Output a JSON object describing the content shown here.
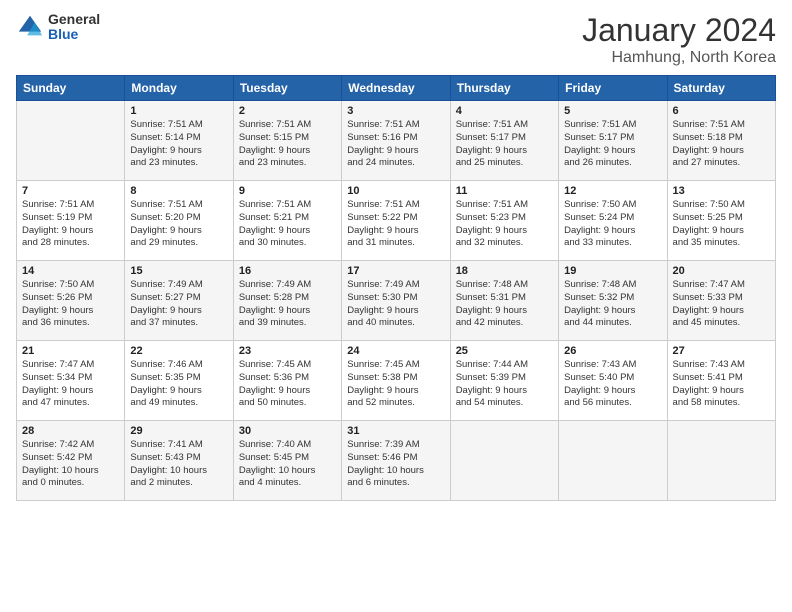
{
  "header": {
    "logo_general": "General",
    "logo_blue": "Blue",
    "month_title": "January 2024",
    "location": "Hamhung, North Korea"
  },
  "columns": [
    "Sunday",
    "Monday",
    "Tuesday",
    "Wednesday",
    "Thursday",
    "Friday",
    "Saturday"
  ],
  "weeks": [
    [
      {
        "day": "",
        "content": ""
      },
      {
        "day": "1",
        "content": "Sunrise: 7:51 AM\nSunset: 5:14 PM\nDaylight: 9 hours\nand 23 minutes."
      },
      {
        "day": "2",
        "content": "Sunrise: 7:51 AM\nSunset: 5:15 PM\nDaylight: 9 hours\nand 23 minutes."
      },
      {
        "day": "3",
        "content": "Sunrise: 7:51 AM\nSunset: 5:16 PM\nDaylight: 9 hours\nand 24 minutes."
      },
      {
        "day": "4",
        "content": "Sunrise: 7:51 AM\nSunset: 5:17 PM\nDaylight: 9 hours\nand 25 minutes."
      },
      {
        "day": "5",
        "content": "Sunrise: 7:51 AM\nSunset: 5:17 PM\nDaylight: 9 hours\nand 26 minutes."
      },
      {
        "day": "6",
        "content": "Sunrise: 7:51 AM\nSunset: 5:18 PM\nDaylight: 9 hours\nand 27 minutes."
      }
    ],
    [
      {
        "day": "7",
        "content": "Sunrise: 7:51 AM\nSunset: 5:19 PM\nDaylight: 9 hours\nand 28 minutes."
      },
      {
        "day": "8",
        "content": "Sunrise: 7:51 AM\nSunset: 5:20 PM\nDaylight: 9 hours\nand 29 minutes."
      },
      {
        "day": "9",
        "content": "Sunrise: 7:51 AM\nSunset: 5:21 PM\nDaylight: 9 hours\nand 30 minutes."
      },
      {
        "day": "10",
        "content": "Sunrise: 7:51 AM\nSunset: 5:22 PM\nDaylight: 9 hours\nand 31 minutes."
      },
      {
        "day": "11",
        "content": "Sunrise: 7:51 AM\nSunset: 5:23 PM\nDaylight: 9 hours\nand 32 minutes."
      },
      {
        "day": "12",
        "content": "Sunrise: 7:50 AM\nSunset: 5:24 PM\nDaylight: 9 hours\nand 33 minutes."
      },
      {
        "day": "13",
        "content": "Sunrise: 7:50 AM\nSunset: 5:25 PM\nDaylight: 9 hours\nand 35 minutes."
      }
    ],
    [
      {
        "day": "14",
        "content": "Sunrise: 7:50 AM\nSunset: 5:26 PM\nDaylight: 9 hours\nand 36 minutes."
      },
      {
        "day": "15",
        "content": "Sunrise: 7:49 AM\nSunset: 5:27 PM\nDaylight: 9 hours\nand 37 minutes."
      },
      {
        "day": "16",
        "content": "Sunrise: 7:49 AM\nSunset: 5:28 PM\nDaylight: 9 hours\nand 39 minutes."
      },
      {
        "day": "17",
        "content": "Sunrise: 7:49 AM\nSunset: 5:30 PM\nDaylight: 9 hours\nand 40 minutes."
      },
      {
        "day": "18",
        "content": "Sunrise: 7:48 AM\nSunset: 5:31 PM\nDaylight: 9 hours\nand 42 minutes."
      },
      {
        "day": "19",
        "content": "Sunrise: 7:48 AM\nSunset: 5:32 PM\nDaylight: 9 hours\nand 44 minutes."
      },
      {
        "day": "20",
        "content": "Sunrise: 7:47 AM\nSunset: 5:33 PM\nDaylight: 9 hours\nand 45 minutes."
      }
    ],
    [
      {
        "day": "21",
        "content": "Sunrise: 7:47 AM\nSunset: 5:34 PM\nDaylight: 9 hours\nand 47 minutes."
      },
      {
        "day": "22",
        "content": "Sunrise: 7:46 AM\nSunset: 5:35 PM\nDaylight: 9 hours\nand 49 minutes."
      },
      {
        "day": "23",
        "content": "Sunrise: 7:45 AM\nSunset: 5:36 PM\nDaylight: 9 hours\nand 50 minutes."
      },
      {
        "day": "24",
        "content": "Sunrise: 7:45 AM\nSunset: 5:38 PM\nDaylight: 9 hours\nand 52 minutes."
      },
      {
        "day": "25",
        "content": "Sunrise: 7:44 AM\nSunset: 5:39 PM\nDaylight: 9 hours\nand 54 minutes."
      },
      {
        "day": "26",
        "content": "Sunrise: 7:43 AM\nSunset: 5:40 PM\nDaylight: 9 hours\nand 56 minutes."
      },
      {
        "day": "27",
        "content": "Sunrise: 7:43 AM\nSunset: 5:41 PM\nDaylight: 9 hours\nand 58 minutes."
      }
    ],
    [
      {
        "day": "28",
        "content": "Sunrise: 7:42 AM\nSunset: 5:42 PM\nDaylight: 10 hours\nand 0 minutes."
      },
      {
        "day": "29",
        "content": "Sunrise: 7:41 AM\nSunset: 5:43 PM\nDaylight: 10 hours\nand 2 minutes."
      },
      {
        "day": "30",
        "content": "Sunrise: 7:40 AM\nSunset: 5:45 PM\nDaylight: 10 hours\nand 4 minutes."
      },
      {
        "day": "31",
        "content": "Sunrise: 7:39 AM\nSunset: 5:46 PM\nDaylight: 10 hours\nand 6 minutes."
      },
      {
        "day": "",
        "content": ""
      },
      {
        "day": "",
        "content": ""
      },
      {
        "day": "",
        "content": ""
      }
    ]
  ]
}
